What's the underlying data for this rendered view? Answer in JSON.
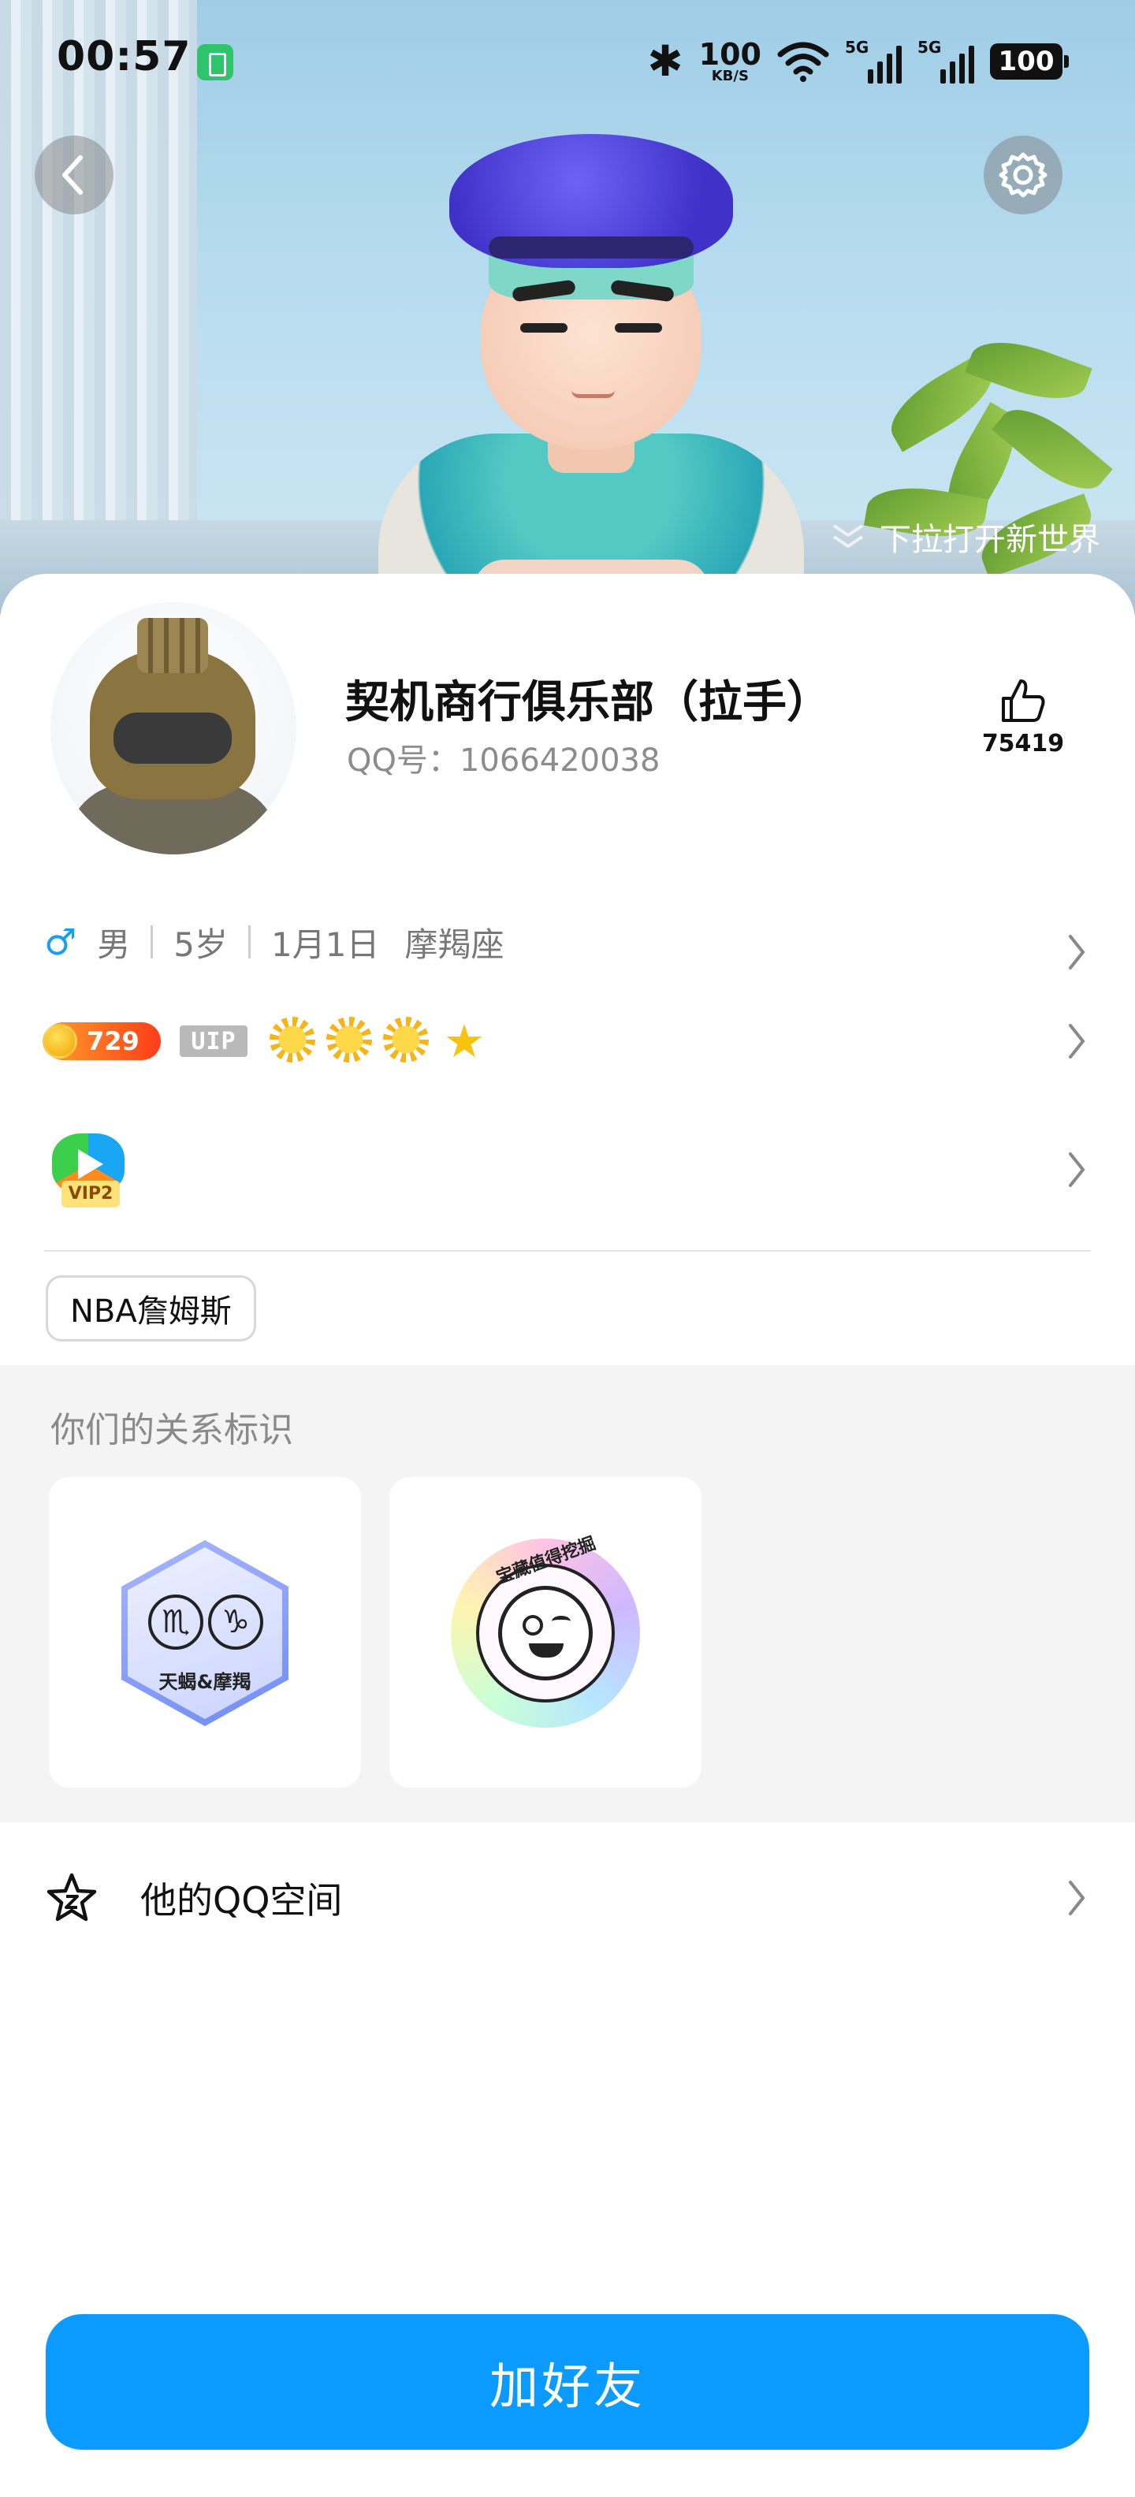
{
  "status_bar": {
    "time": "00:57",
    "speed_value": "100",
    "speed_unit": "KB/S",
    "sim1": "5G",
    "sim2": "5G",
    "battery": "100"
  },
  "header": {
    "pull_hint": "下拉打开新世界"
  },
  "profile": {
    "nickname": "契机商行俱乐部（拉手）",
    "qq_number": "QQ号：1066420038",
    "likes": "75419",
    "gender": "男",
    "age": "5岁",
    "birthday": "1月1日",
    "zodiac": "摩羯座"
  },
  "vip": {
    "level": "729",
    "uip_label": "UIP",
    "vip2_label": "VIP2"
  },
  "tags": [
    "NBA詹姆斯"
  ],
  "relation": {
    "title": "你们的关系标识",
    "badges": [
      {
        "label": "天蝎&摩羯"
      },
      {
        "label": "宝藏值得挖掘"
      }
    ]
  },
  "zone": {
    "label": "他的QQ空间"
  },
  "actions": {
    "add_friend": "加好友"
  },
  "colors": {
    "primary_button": "#0b9bff",
    "gender_male": "#1a9ef2"
  }
}
